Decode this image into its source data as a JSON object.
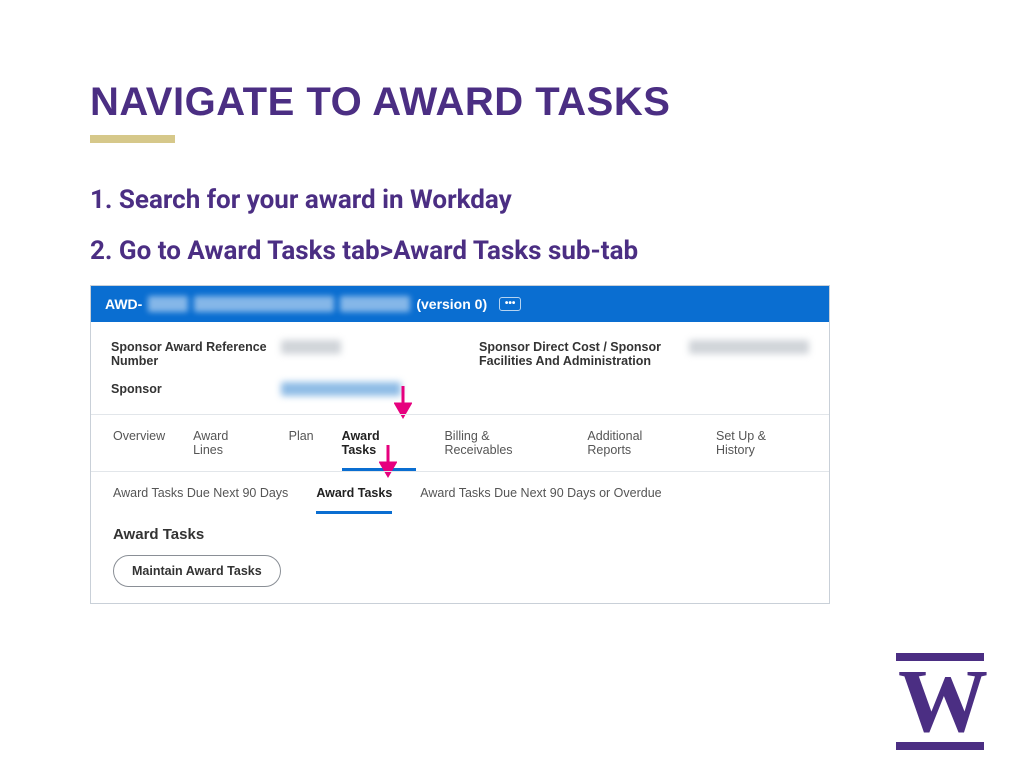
{
  "title": "NAVIGATE TO AWARD TASKS",
  "steps": [
    "1. Search for your award in Workday",
    "2. Go to Award Tasks tab>Award Tasks sub-tab"
  ],
  "screenshot": {
    "header_prefix": "AWD-",
    "header_version": "(version 0)",
    "fields_left": [
      {
        "label": "Sponsor Award Reference Number"
      },
      {
        "label": "Sponsor"
      }
    ],
    "fields_right": [
      {
        "label": "Sponsor Direct Cost / Sponsor Facilities And Administration"
      }
    ],
    "tabs_primary": [
      "Overview",
      "Award Lines",
      "Plan",
      "Award Tasks",
      "Billing & Receivables",
      "Additional Reports",
      "Set Up & History"
    ],
    "tabs_primary_active": "Award Tasks",
    "tabs_secondary": [
      "Award Tasks Due Next 90 Days",
      "Award Tasks",
      "Award Tasks Due Next 90 Days or Overdue"
    ],
    "tabs_secondary_active": "Award Tasks",
    "section_title": "Award Tasks",
    "button": "Maintain Award Tasks"
  },
  "logo_letter": "W"
}
